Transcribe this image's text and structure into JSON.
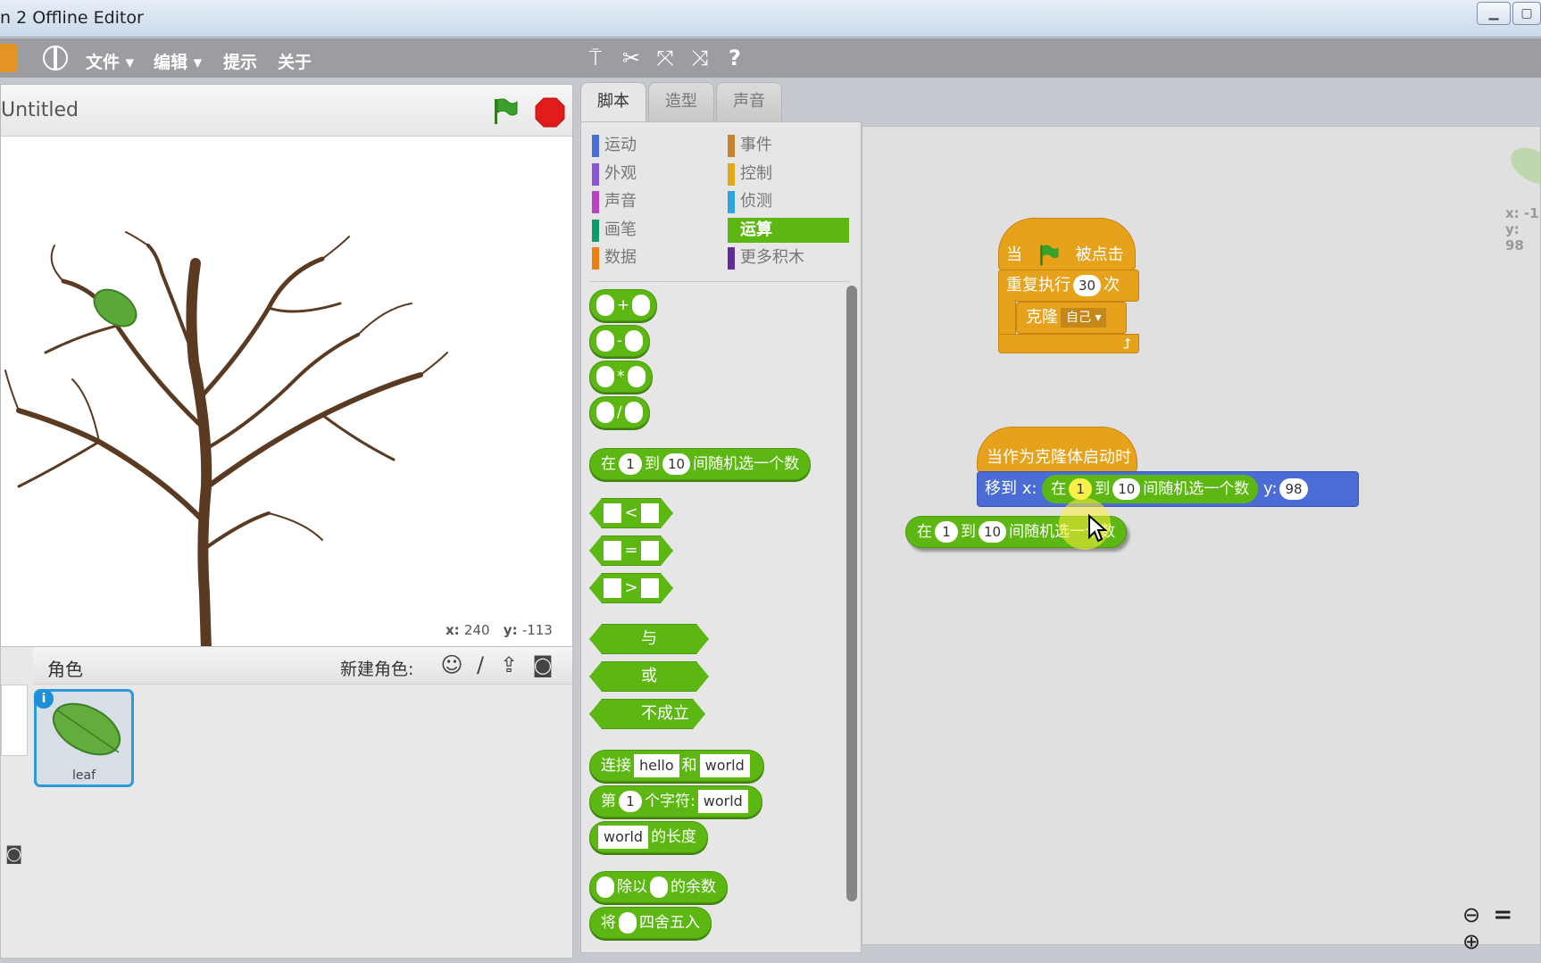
{
  "window": {
    "title": "n 2 Offline Editor"
  },
  "menu": {
    "items": [
      "文件 ▾",
      "编辑 ▾",
      "提示",
      "关于"
    ]
  },
  "stage": {
    "title": "Untitled",
    "coords_x_label": "x:",
    "coords_x": "240",
    "coords_y_label": "y:",
    "coords_y": "-113"
  },
  "sprites": {
    "header_label": "角色",
    "new_sprite_label": "新建角色:",
    "items": [
      {
        "name": "leaf"
      }
    ]
  },
  "tabs": [
    "脚本",
    "造型",
    "声音"
  ],
  "categories": {
    "left": [
      "运动",
      "外观",
      "声音",
      "画笔",
      "数据"
    ],
    "right": [
      "事件",
      "控制",
      "侦测",
      "运算",
      "更多积木"
    ],
    "selected": "运算",
    "colors": {
      "运动": "#4a6cd4",
      "外观": "#8a55d7",
      "声音": "#bb42c3",
      "画笔": "#0e9a6c",
      "数据": "#ee7d16",
      "事件": "#c88330",
      "控制": "#e1a91a",
      "侦测": "#2ca5e2",
      "运算": "#5cb712",
      "更多积木": "#632d99"
    }
  },
  "palette_blocks": {
    "plus": "+",
    "minus": "-",
    "times": "*",
    "divide": "/",
    "random": {
      "a": "在",
      "v1": "1",
      "b": "到",
      "v2": "10",
      "c": "间随机选一个数"
    },
    "lt": "<",
    "eq": "=",
    "gt": ">",
    "and": "与",
    "or": "或",
    "not": "不成立",
    "join": {
      "a": "连接",
      "v1": "hello",
      "b": "和",
      "v2": "world"
    },
    "letter": {
      "a": "第",
      "v1": "1",
      "b": "个字符:",
      "v2": "world"
    },
    "length": {
      "v1": "world",
      "a": "的长度"
    },
    "mod": {
      "a": "除以",
      "b": "的余数"
    },
    "round": {
      "a": "将",
      "b": "四舍五入"
    }
  },
  "scripts": {
    "hat1": {
      "a": "当",
      "b": "被点击"
    },
    "repeat": {
      "a": "重复执行",
      "v": "30",
      "b": "次"
    },
    "clone": {
      "a": "克隆",
      "v": "自己 ▾"
    },
    "hat2": "当作为克隆体启动时",
    "goto": {
      "a": "移到 x:",
      "r_a": "在",
      "r_v1": "1",
      "r_b": "到",
      "r_v2": "10",
      "r_c": "间随机选一个数",
      "y_label": "y:",
      "y_v": "98"
    },
    "loose": {
      "a": "在",
      "v1": "1",
      "b": "到",
      "v2": "10",
      "c": "间随机选一个数"
    }
  },
  "script_coords": {
    "x": "x: -1",
    "y": "y: 98"
  },
  "zoom": {
    "out": "🔍−",
    "reset": "=",
    "in": "🔍"
  }
}
